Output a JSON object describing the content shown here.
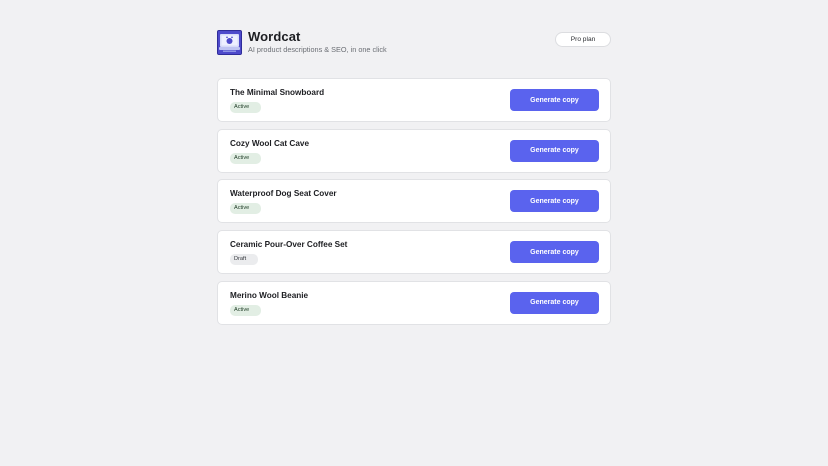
{
  "app": {
    "title": "Wordcat",
    "subtitle": "AI product descriptions & SEO, in one click",
    "logo_icon": "cat-laptop-icon",
    "plan_label": "Pro plan"
  },
  "colors": {
    "page_background": "#f1f1f3",
    "accent": "#5a63ee",
    "active_badge": "#e2eee4",
    "draft_badge": "#ebecee"
  },
  "products": [
    {
      "name": "The Minimal Snowboard",
      "status": "Active",
      "action_label": "Generate copy"
    },
    {
      "name": "Cozy Wool Cat Cave",
      "status": "Active",
      "action_label": "Generate copy"
    },
    {
      "name": "Waterproof Dog Seat Cover",
      "status": "Active",
      "action_label": "Generate copy"
    },
    {
      "name": "Ceramic Pour-Over Coffee Set",
      "status": "Draft",
      "action_label": "Generate copy"
    },
    {
      "name": "Merino Wool Beanie",
      "status": "Active",
      "action_label": "Generate copy"
    }
  ]
}
